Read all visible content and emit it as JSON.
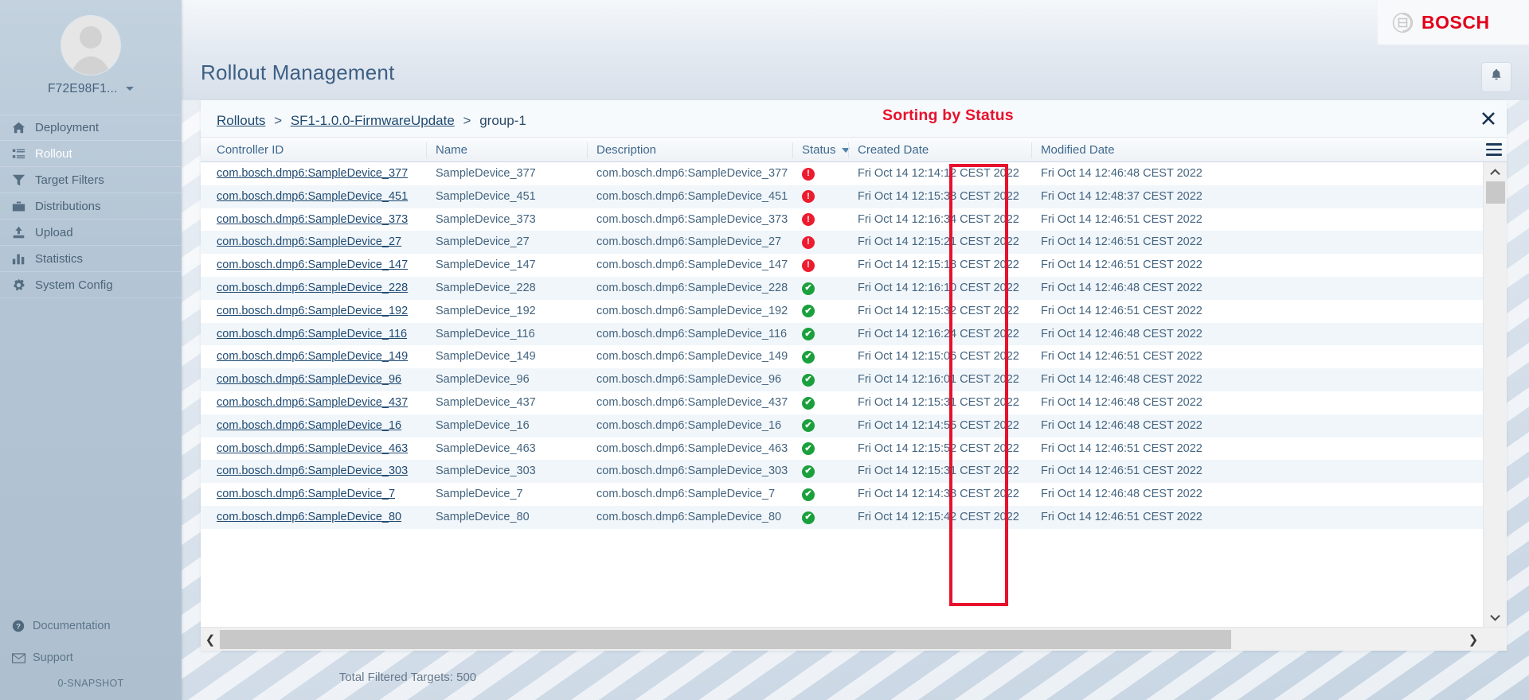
{
  "brand": {
    "name": "BOSCH",
    "accent": "#e2001a"
  },
  "sidebar": {
    "user": "F72E98F1...",
    "items": [
      {
        "label": "Deployment",
        "icon": "home-icon",
        "active": false
      },
      {
        "label": "Rollout",
        "icon": "list-icon",
        "active": true
      },
      {
        "label": "Target Filters",
        "icon": "filter-icon",
        "active": false
      },
      {
        "label": "Distributions",
        "icon": "briefcase-icon",
        "active": false
      },
      {
        "label": "Upload",
        "icon": "upload-icon",
        "active": false
      },
      {
        "label": "Statistics",
        "icon": "bar-chart-icon",
        "active": false
      },
      {
        "label": "System Config",
        "icon": "gear-icon",
        "active": false
      }
    ],
    "documentation": "Documentation",
    "support": "Support",
    "version": "0-SNAPSHOT"
  },
  "header": {
    "title": "Rollout Management"
  },
  "breadcrumb": {
    "root": "Rollouts",
    "sep": ">",
    "rollout": "SF1-1.0.0-FirmwareUpdate",
    "group": "group-1"
  },
  "annotation": {
    "text": "Sorting by Status",
    "color": "#e8112d"
  },
  "table": {
    "columns": [
      "Controller ID",
      "Name",
      "Description",
      "Status",
      "Created Date",
      "Modified Date"
    ],
    "sorted_by": "Status",
    "sort_direction": "desc",
    "rows": [
      {
        "controller_id": "com.bosch.dmp6:SampleDevice_377",
        "name": "SampleDevice_377",
        "description": "com.bosch.dmp6:SampleDevice_377",
        "status": "error",
        "created": "Fri Oct 14 12:14:12 CEST 2022",
        "modified": "Fri Oct 14 12:46:48 CEST 2022"
      },
      {
        "controller_id": "com.bosch.dmp6:SampleDevice_451",
        "name": "SampleDevice_451",
        "description": "com.bosch.dmp6:SampleDevice_451",
        "status": "error",
        "created": "Fri Oct 14 12:15:38 CEST 2022",
        "modified": "Fri Oct 14 12:48:37 CEST 2022"
      },
      {
        "controller_id": "com.bosch.dmp6:SampleDevice_373",
        "name": "SampleDevice_373",
        "description": "com.bosch.dmp6:SampleDevice_373",
        "status": "error",
        "created": "Fri Oct 14 12:16:34 CEST 2022",
        "modified": "Fri Oct 14 12:46:51 CEST 2022"
      },
      {
        "controller_id": "com.bosch.dmp6:SampleDevice_27",
        "name": "SampleDevice_27",
        "description": "com.bosch.dmp6:SampleDevice_27",
        "status": "error",
        "created": "Fri Oct 14 12:15:21 CEST 2022",
        "modified": "Fri Oct 14 12:46:51 CEST 2022"
      },
      {
        "controller_id": "com.bosch.dmp6:SampleDevice_147",
        "name": "SampleDevice_147",
        "description": "com.bosch.dmp6:SampleDevice_147",
        "status": "error",
        "created": "Fri Oct 14 12:15:18 CEST 2022",
        "modified": "Fri Oct 14 12:46:51 CEST 2022"
      },
      {
        "controller_id": "com.bosch.dmp6:SampleDevice_228",
        "name": "SampleDevice_228",
        "description": "com.bosch.dmp6:SampleDevice_228",
        "status": "ok",
        "created": "Fri Oct 14 12:16:10 CEST 2022",
        "modified": "Fri Oct 14 12:46:48 CEST 2022"
      },
      {
        "controller_id": "com.bosch.dmp6:SampleDevice_192",
        "name": "SampleDevice_192",
        "description": "com.bosch.dmp6:SampleDevice_192",
        "status": "ok",
        "created": "Fri Oct 14 12:15:32 CEST 2022",
        "modified": "Fri Oct 14 12:46:51 CEST 2022"
      },
      {
        "controller_id": "com.bosch.dmp6:SampleDevice_116",
        "name": "SampleDevice_116",
        "description": "com.bosch.dmp6:SampleDevice_116",
        "status": "ok",
        "created": "Fri Oct 14 12:16:24 CEST 2022",
        "modified": "Fri Oct 14 12:46:48 CEST 2022"
      },
      {
        "controller_id": "com.bosch.dmp6:SampleDevice_149",
        "name": "SampleDevice_149",
        "description": "com.bosch.dmp6:SampleDevice_149",
        "status": "ok",
        "created": "Fri Oct 14 12:15:06 CEST 2022",
        "modified": "Fri Oct 14 12:46:51 CEST 2022"
      },
      {
        "controller_id": "com.bosch.dmp6:SampleDevice_96",
        "name": "SampleDevice_96",
        "description": "com.bosch.dmp6:SampleDevice_96",
        "status": "ok",
        "created": "Fri Oct 14 12:16:01 CEST 2022",
        "modified": "Fri Oct 14 12:46:48 CEST 2022"
      },
      {
        "controller_id": "com.bosch.dmp6:SampleDevice_437",
        "name": "SampleDevice_437",
        "description": "com.bosch.dmp6:SampleDevice_437",
        "status": "ok",
        "created": "Fri Oct 14 12:15:31 CEST 2022",
        "modified": "Fri Oct 14 12:46:48 CEST 2022"
      },
      {
        "controller_id": "com.bosch.dmp6:SampleDevice_16",
        "name": "SampleDevice_16",
        "description": "com.bosch.dmp6:SampleDevice_16",
        "status": "ok",
        "created": "Fri Oct 14 12:14:55 CEST 2022",
        "modified": "Fri Oct 14 12:46:48 CEST 2022"
      },
      {
        "controller_id": "com.bosch.dmp6:SampleDevice_463",
        "name": "SampleDevice_463",
        "description": "com.bosch.dmp6:SampleDevice_463",
        "status": "ok",
        "created": "Fri Oct 14 12:15:52 CEST 2022",
        "modified": "Fri Oct 14 12:46:51 CEST 2022"
      },
      {
        "controller_id": "com.bosch.dmp6:SampleDevice_303",
        "name": "SampleDevice_303",
        "description": "com.bosch.dmp6:SampleDevice_303",
        "status": "ok",
        "created": "Fri Oct 14 12:15:31 CEST 2022",
        "modified": "Fri Oct 14 12:46:51 CEST 2022"
      },
      {
        "controller_id": "com.bosch.dmp6:SampleDevice_7",
        "name": "SampleDevice_7",
        "description": "com.bosch.dmp6:SampleDevice_7",
        "status": "ok",
        "created": "Fri Oct 14 12:14:38 CEST 2022",
        "modified": "Fri Oct 14 12:46:48 CEST 2022"
      },
      {
        "controller_id": "com.bosch.dmp6:SampleDevice_80",
        "name": "SampleDevice_80",
        "description": "com.bosch.dmp6:SampleDevice_80",
        "status": "ok",
        "created": "Fri Oct 14 12:15:42 CEST 2022",
        "modified": "Fri Oct 14 12:46:51 CEST 2022"
      }
    ],
    "status_colors": {
      "error": "#ed1b2e",
      "ok": "#1aa03c"
    }
  },
  "footer": {
    "total": "Total Filtered Targets: 500"
  }
}
